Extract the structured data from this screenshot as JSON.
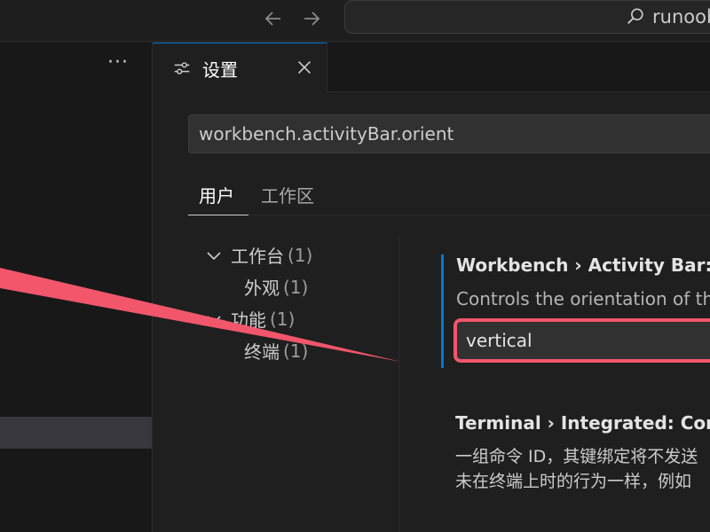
{
  "titlebar": {
    "command_center_text": "runoob"
  },
  "sidebar": {
    "more_label": "···"
  },
  "tab": {
    "label": "设置"
  },
  "settings": {
    "search_value": "workbench.activityBar.orient",
    "scopes": {
      "user": "用户",
      "workspace": "工作区"
    },
    "toc": [
      {
        "label": "工作台",
        "count": "(1)",
        "expanded": true
      },
      {
        "label": "外观",
        "count": "(1)"
      },
      {
        "label": "功能",
        "count": "(1)",
        "expanded": true
      },
      {
        "label": "终端",
        "count": "(1)"
      }
    ],
    "items": [
      {
        "title": "Workbench › Activity Bar: O",
        "description": "Controls the orientation of th",
        "value": "vertical"
      },
      {
        "title": "Terminal › Integrated: Comm",
        "description_lines": [
          "一组命令 ID，其键绑定将不发送",
          "未在终端上时的行为一样，例如"
        ]
      }
    ]
  },
  "colors": {
    "accent": "#0078d4",
    "annotation": "#f2566b"
  }
}
